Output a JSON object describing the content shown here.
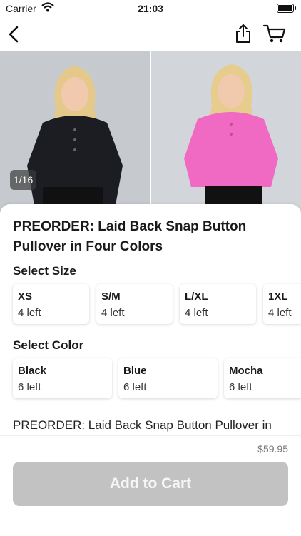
{
  "status_bar": {
    "carrier": "Carrier",
    "time": "21:03"
  },
  "icons": {
    "back": "chevron-left-icon",
    "share": "share-icon",
    "cart": "cart-icon",
    "wifi": "wifi-icon",
    "battery": "battery-icon"
  },
  "gallery": {
    "counter": "1/16",
    "photos": [
      {
        "color_name": "Black",
        "shirt": "#1b1d22"
      },
      {
        "color_name": "Pink",
        "shirt": "#f06ac4"
      }
    ]
  },
  "product": {
    "title": "PREORDER: Laid Back Snap Button Pullover in Four Colors"
  },
  "size": {
    "label": "Select Size",
    "options": [
      {
        "name": "XS",
        "stock": "4 left"
      },
      {
        "name": "S/M",
        "stock": "4 left"
      },
      {
        "name": "L/XL",
        "stock": "4 left"
      },
      {
        "name": "1XL",
        "stock": "4 left"
      }
    ]
  },
  "color": {
    "label": "Select Color",
    "options": [
      {
        "name": "Black",
        "stock": "6 left"
      },
      {
        "name": "Blue",
        "stock": "6 left"
      },
      {
        "name": "Mocha",
        "stock": "6 left"
      }
    ]
  },
  "description": "PREORDER: Laid Back Snap Button Pullover in",
  "footer": {
    "price": "$59.95",
    "add_to_cart": "Add to Cart"
  },
  "colors": {
    "button_disabled": "#c2c2c2",
    "text": "#1a1a1a"
  }
}
